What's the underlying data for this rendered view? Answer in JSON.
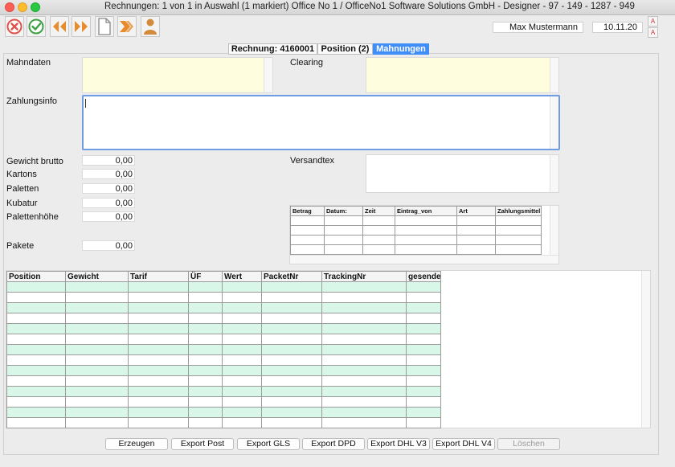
{
  "window": {
    "title": "Rechnungen: 1 von 1 in Auswahl  (1 markiert) Office No 1 /  OfficeNo1 Software Solutions GmbH - Designer - 97 - 149 - 1287 - 949"
  },
  "toolbar": {
    "buttons": [
      {
        "icon": "cancel-icon",
        "color": "#e0524a"
      },
      {
        "icon": "confirm-icon",
        "color": "#3ea043"
      },
      {
        "icon": "previous-icon",
        "color": "#e88b2c"
      },
      {
        "icon": "next-icon",
        "color": "#e88b2c"
      },
      {
        "icon": "new-document-icon",
        "color": "#888888"
      },
      {
        "icon": "forward-icon",
        "color": "#e88b2c"
      },
      {
        "icon": "user-icon",
        "color": "#d38a3b"
      }
    ],
    "user_name": "Max Mustermann",
    "date": "10.11.20"
  },
  "tabs": [
    {
      "label": "Rechnung:  4160001",
      "active": false
    },
    {
      "label": "Position (2)",
      "active": false
    },
    {
      "label": "Mahnungen",
      "active": true
    }
  ],
  "form": {
    "mahndaten_label": "Mahndaten",
    "clearing_label": "Clearing",
    "zahlungsinfo_label": "Zahlungsinfo",
    "versandtext_label": "Versandtex",
    "fields": [
      {
        "label": "Gewicht brutto",
        "value": "0,00"
      },
      {
        "label": "Kartons",
        "value": "0,00"
      },
      {
        "label": "Paletten",
        "value": "0,00"
      },
      {
        "label": "Kubatur",
        "value": "0,00"
      },
      {
        "label": "Palettenhöhe",
        "value": "0,00"
      },
      {
        "label": "Pakete",
        "value": "0,00"
      }
    ]
  },
  "payments_table": {
    "headers": [
      "Betrag",
      "Datum:",
      "Zeit",
      "Eintrag_von",
      "Art",
      "Zahlungsmittel"
    ],
    "rows": 4
  },
  "shipments_table": {
    "headers": [
      "Position",
      "Gewicht",
      "Tarif",
      "ÜF",
      "Wert",
      "PacketNr",
      "TrackingNr",
      "gesendet"
    ],
    "rows": 14
  },
  "bottom_buttons": [
    {
      "label": "Erzeugen",
      "enabled": true
    },
    {
      "label": "Export Post",
      "enabled": true
    },
    {
      "label": "Export GLS",
      "enabled": true
    },
    {
      "label": "Export DPD",
      "enabled": true
    },
    {
      "label": "Export DHL V3",
      "enabled": true
    },
    {
      "label": "Export DHL V4",
      "enabled": true
    },
    {
      "label": "Löschen",
      "enabled": false
    }
  ]
}
